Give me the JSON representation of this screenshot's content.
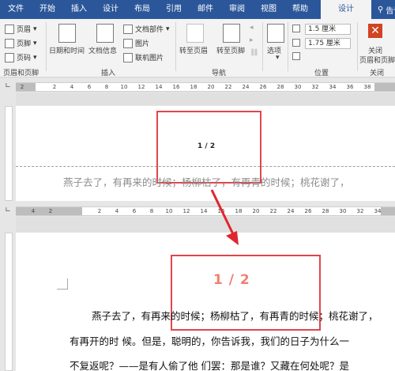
{
  "tabs": [
    "文件",
    "开始",
    "插入",
    "设计",
    "布局",
    "引用",
    "邮件",
    "审阅",
    "视图",
    "帮助"
  ],
  "active_tab": "设计",
  "tell_me": "告诉我",
  "ribbon": {
    "header_footer": {
      "header": "页眉",
      "footer": "页脚",
      "page_number": "页码",
      "group": "页眉和页脚"
    },
    "insert": {
      "date_time": "日期和时间",
      "doc_info": "文档信息",
      "doc_parts": "文档部件",
      "picture": "图片",
      "online_picture": "联机图片",
      "group": "插入"
    },
    "navigation": {
      "goto_header": "转至页眉",
      "goto_footer": "转至页脚",
      "group": "导航"
    },
    "options": {
      "label": "选项"
    },
    "position": {
      "header_dist": "1.5 厘米",
      "footer_dist": "1.75 厘米",
      "group": "位置"
    },
    "close": {
      "label": "关闭",
      "sublabel": "页眉和页脚",
      "group": "关闭"
    }
  },
  "ruler_top": [
    "2",
    "2",
    "4",
    "6",
    "8",
    "10",
    "12",
    "14",
    "16",
    "18",
    "20",
    "22",
    "24",
    "26",
    "28",
    "30",
    "32",
    "34",
    "36",
    "38"
  ],
  "ruler_mid": [
    "4",
    "2",
    "2",
    "4",
    "6",
    "8",
    "10",
    "12",
    "14",
    "16",
    "18",
    "20",
    "22",
    "24",
    "26",
    "28",
    "30",
    "32",
    "34"
  ],
  "page1": {
    "page_number": "1 / 2",
    "faded_line": "燕子去了，有再来的时候；杨柳枯了，有再青的时候；桃花谢了，"
  },
  "page2": {
    "page_number": "1 / 2",
    "lines": [
      "燕子去了，有再来的时候；杨柳枯了，有再青的时候；桃花谢了，",
      "有再开的时 候。但是，聪明的，你告诉我，我们的日子为什么一",
      "不复返呢？——是有人偷了他 们罢：那是谁？又藏在何处呢？是"
    ]
  }
}
